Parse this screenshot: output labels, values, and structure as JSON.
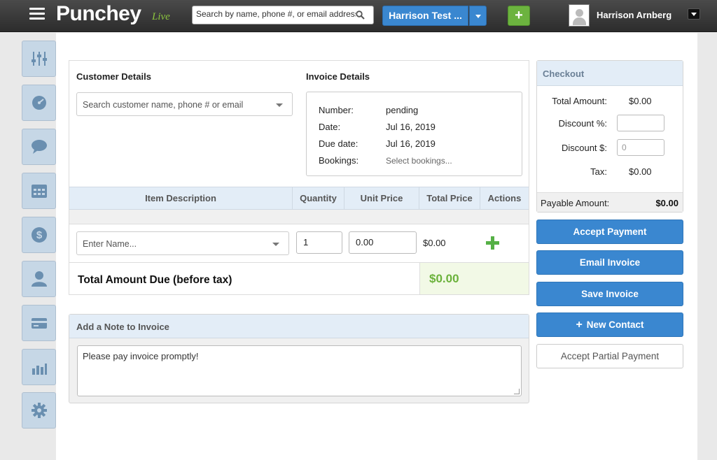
{
  "topbar": {
    "brand": "Punchey",
    "brand_suffix": "Live",
    "search_placeholder": "Search by name, phone #, or email address",
    "account_label": "Harrison Test ...",
    "add_label": "+",
    "user_name": "Harrison Arnberg"
  },
  "sidebar": {
    "items": [
      {
        "icon": "sliders-icon"
      },
      {
        "icon": "dashboard-icon"
      },
      {
        "icon": "chat-icon"
      },
      {
        "icon": "calendar-icon"
      },
      {
        "icon": "dollar-icon"
      },
      {
        "icon": "user-icon"
      },
      {
        "icon": "payment-card-icon"
      },
      {
        "icon": "bar-chart-icon"
      },
      {
        "icon": "gear-icon"
      }
    ]
  },
  "customer": {
    "title": "Customer Details",
    "search_placeholder": "Search customer name, phone # or email"
  },
  "invoice": {
    "title": "Invoice Details",
    "number_label": "Number:",
    "number_value": "pending",
    "date_label": "Date:",
    "date_value": "Jul 16, 2019",
    "due_label": "Due date:",
    "due_value": "Jul 16, 2019",
    "bookings_label": "Bookings:",
    "bookings_value": "Select bookings..."
  },
  "items_table": {
    "columns": [
      "Item Description",
      "Quantity",
      "Unit Price",
      "Total Price",
      "Actions"
    ],
    "row": {
      "name_placeholder": "Enter Name...",
      "quantity": "1",
      "unit_price": "0.00",
      "total_price": "$0.00"
    },
    "total_label": "Total Amount Due (before tax)",
    "total_value": "$0.00"
  },
  "note": {
    "title": "Add a Note to Invoice",
    "text": "Please pay invoice promptly!"
  },
  "checkout": {
    "title": "Checkout",
    "total_label": "Total Amount:",
    "total_value": "$0.00",
    "discount_pct_label": "Discount %:",
    "discount_pct_value": "",
    "discount_amt_label": "Discount $:",
    "discount_amt_placeholder": "0",
    "tax_label": "Tax:",
    "tax_value": "$0.00",
    "payable_label": "Payable Amount:",
    "payable_value": "$0.00"
  },
  "actions": {
    "accept_payment": "Accept Payment",
    "email_invoice": "Email Invoice",
    "save_invoice": "Save Invoice",
    "new_contact": "New Contact",
    "accept_partial": "Accept Partial Payment"
  },
  "colors": {
    "primary": "#3a87d0",
    "success": "#6bb23b",
    "header_bg": "#e3edf7"
  }
}
